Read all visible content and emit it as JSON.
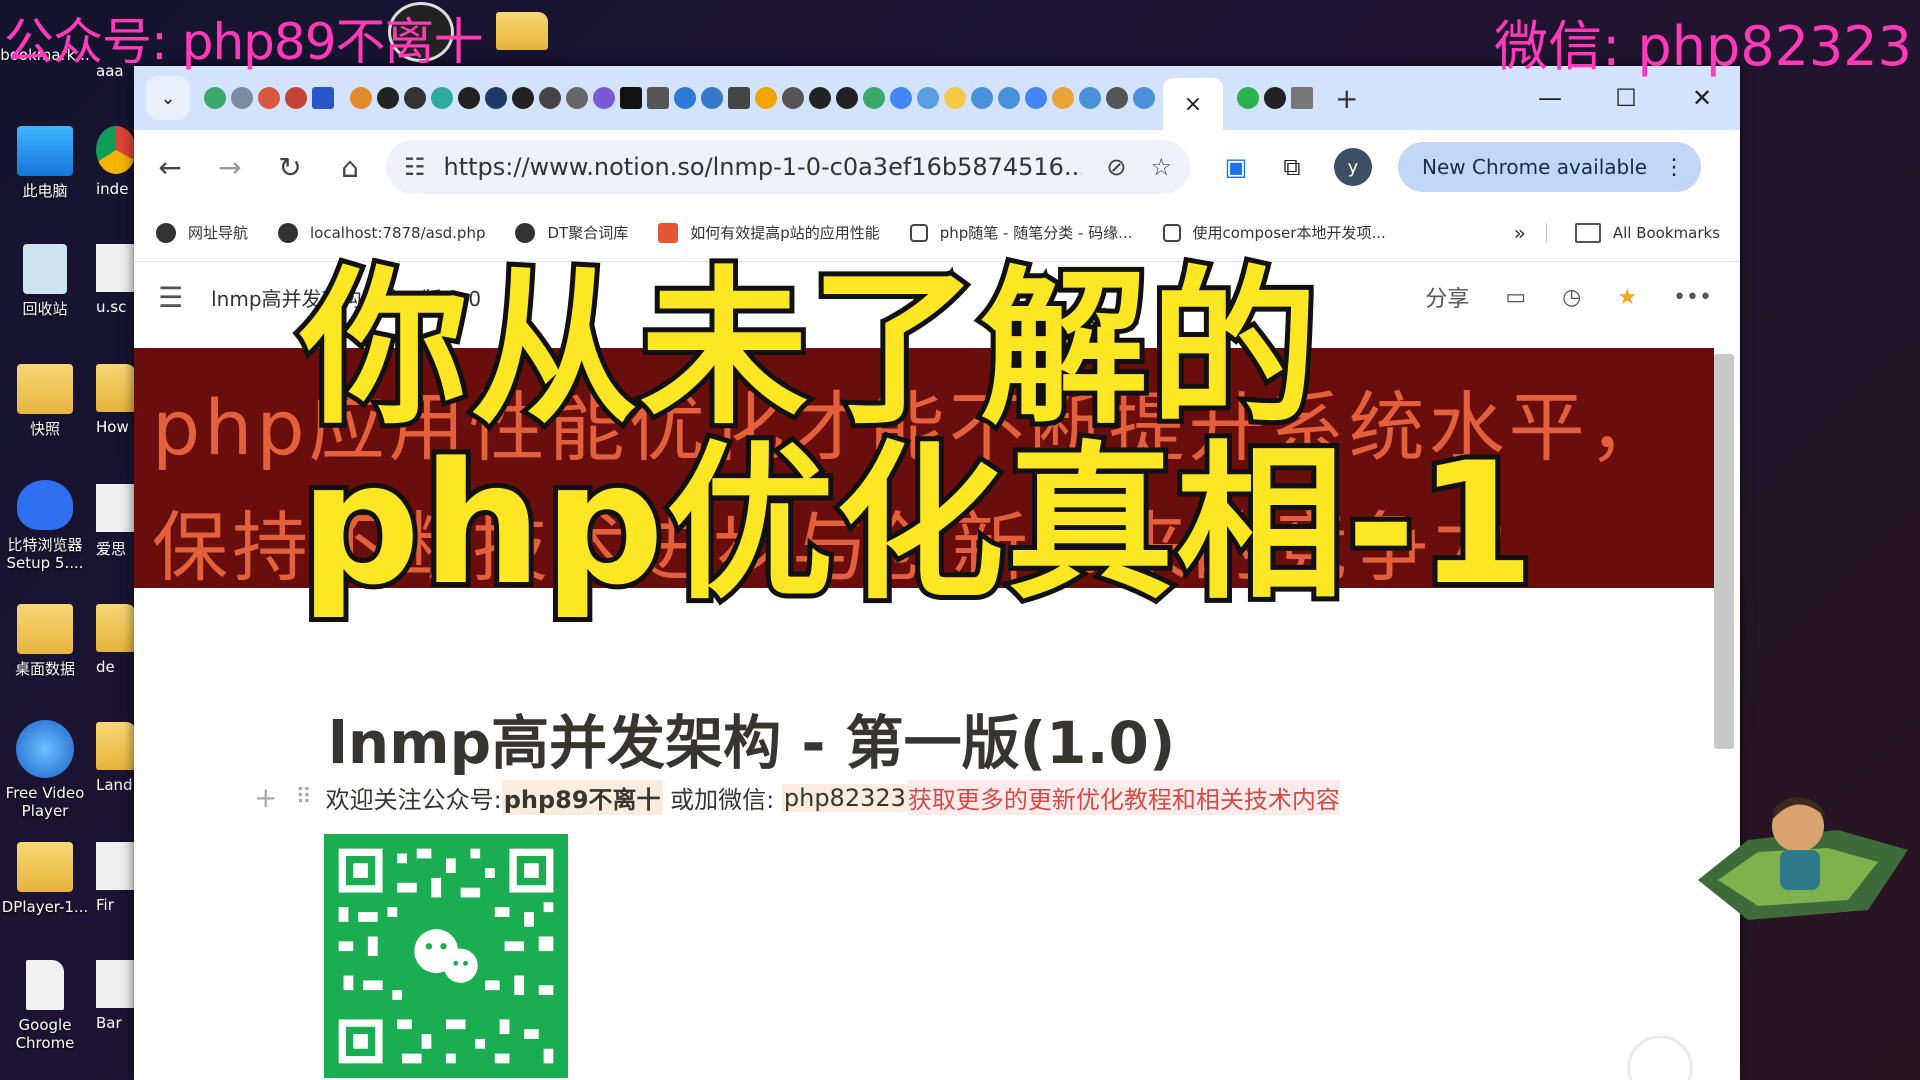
{
  "overlay": {
    "top_left": "公众号: php89不离十",
    "top_right": "微信: php82323",
    "big_title_line1": "你从未了解的",
    "big_title_line2": "php优化真相-1"
  },
  "desktop": {
    "icons_left": [
      {
        "label": "bookmark..."
      },
      {
        "label": "此电脑"
      },
      {
        "label": "回收站"
      },
      {
        "label": "快照"
      },
      {
        "label": "比特浏览器 Setup 5...."
      },
      {
        "label": "桌面数据"
      },
      {
        "label": "Free Video Player"
      },
      {
        "label": "DPlayer-1..."
      },
      {
        "label": "Google Chrome"
      }
    ],
    "icons_right": [
      {
        "label": "aaa"
      },
      {
        "label": "inde"
      },
      {
        "label": "u.sc"
      },
      {
        "label": "How"
      },
      {
        "label": "爱思"
      },
      {
        "label": "de"
      },
      {
        "label": "Land"
      },
      {
        "label": "Fir"
      },
      {
        "label": "Bar"
      }
    ]
  },
  "browser": {
    "tab_close": "×",
    "new_tab": "+",
    "window": {
      "minimize": "—",
      "maximize": "☐",
      "close": "✕"
    },
    "url": "https://www.notion.so/lnmp-1-0-c0a3ef16b5874516...",
    "profile_initial": "y",
    "update_label": "New Chrome available",
    "bookmarks": [
      {
        "label": "网址导航"
      },
      {
        "label": "localhost:7878/asd.php"
      },
      {
        "label": "DT聚合词库"
      },
      {
        "label": "如何有效提高p站的应用性能"
      },
      {
        "label": "php随笔 - 随笔分类 - 码缘..."
      },
      {
        "label": "使用composer本地开发项..."
      }
    ],
    "bookmarks_more": "»",
    "all_bookmarks": "All Bookmarks"
  },
  "notion": {
    "breadcrumb": "lnmp高并发架构 - 第一版(1.0",
    "share_label": "分享",
    "cover_line1": "php应用性能优化才能不断提升系统水平，",
    "cover_line2": "保持不断技术进步与创新带来的竞争力",
    "page_title": "lnmp高并发架构 - 第一版(1.0)",
    "block": {
      "prefix": "欢迎关注公众号: ",
      "account": "php89不离十",
      "mid": " 或加微信: ",
      "wechat": "php82323",
      "suffix": " 获取更多的更新优化教程和相关技术内容"
    }
  },
  "colors": {
    "overlay_text": "#ff3ab8",
    "big_title": "#fde725",
    "cover_bg": "#6a0d0d",
    "tabstrip": "#d3e3fd",
    "qr_bg": "#1aad52"
  }
}
